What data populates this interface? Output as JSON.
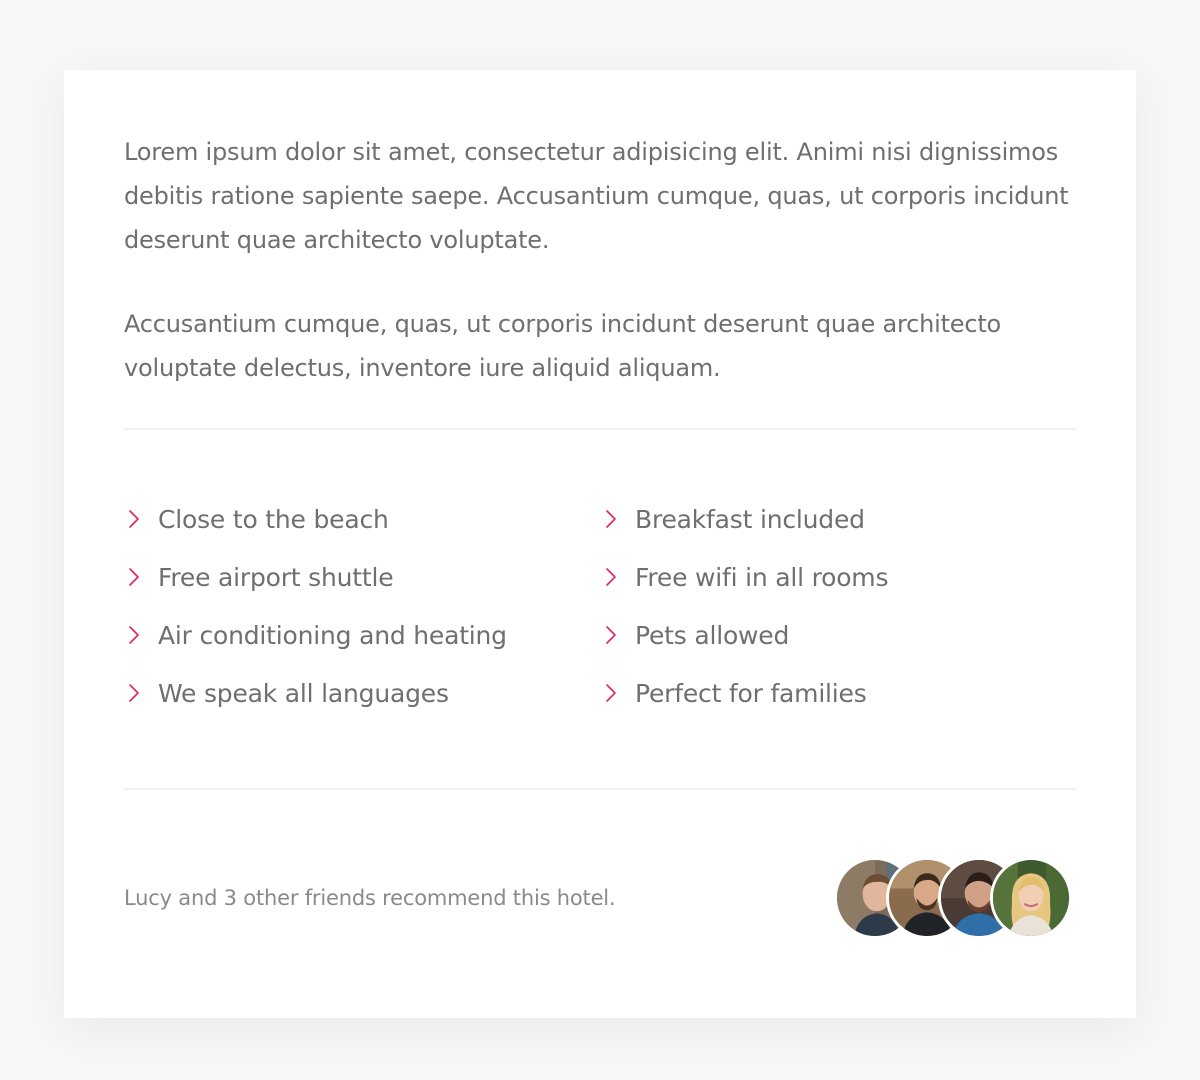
{
  "description": {
    "paragraph_1": "Lorem ipsum dolor sit amet, consectetur adipisicing elit. Animi nisi dignissimos debitis ratione sapiente saepe. Accusantium cumque, quas, ut corporis incidunt deserunt quae architecto voluptate.",
    "paragraph_2": "Accusantium cumque, quas, ut corporis incidunt deserunt quae architecto voluptate delectus, inventore iure aliquid aliquam."
  },
  "features": {
    "left": [
      "Close to the beach",
      "Free airport shuttle",
      "Air conditioning and heating",
      "We speak all languages"
    ],
    "right": [
      "Breakfast included",
      "Free wifi in all rooms",
      "Pets allowed",
      "Perfect for families"
    ],
    "icon": "chevron-right-icon",
    "icon_color": "#e3245f"
  },
  "footer": {
    "recommend_text": "Lucy and 3 other friends recommend this hotel.",
    "avatars": [
      {
        "name": "avatar-friend-1"
      },
      {
        "name": "avatar-friend-2"
      },
      {
        "name": "avatar-friend-3"
      },
      {
        "name": "avatar-lucy"
      }
    ]
  },
  "colors": {
    "accent": "#e3245f",
    "text": "#6f6f6f",
    "muted_text": "#8a8a8a",
    "divider": "#f1f1f1",
    "background": "#f7f7f7",
    "card": "#ffffff"
  }
}
